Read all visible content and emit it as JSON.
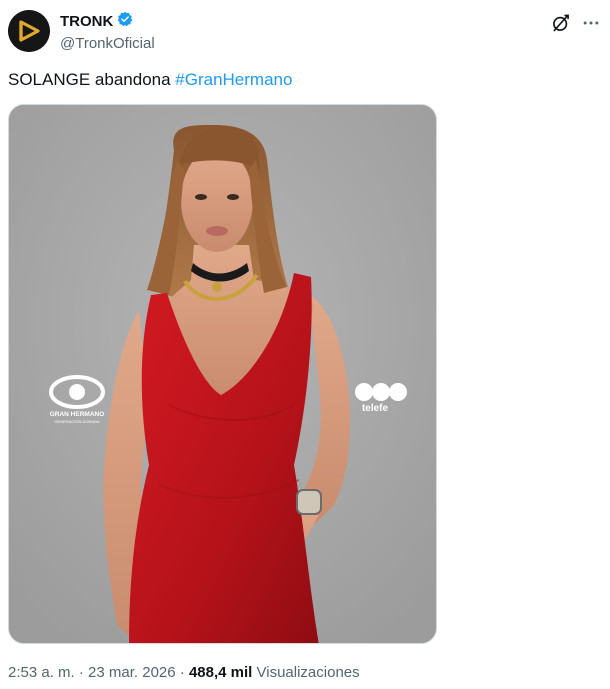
{
  "author": {
    "display_name": "TRONK",
    "handle": "@TronkOficial",
    "verified": true
  },
  "tweet": {
    "text": "SOLANGE abandona ",
    "hashtag": "#GranHermano"
  },
  "media": {
    "logo_left_line1": "GRAN HERMANO",
    "logo_left_line2": "GENERACIÓN DORADA",
    "logo_right": "telefe"
  },
  "meta": {
    "time": "2:53 a. m.",
    "separator": " · ",
    "date": "23 mar. 2026",
    "views_count": "488,4 mil",
    "views_label": "Visualizaciones"
  },
  "colors": {
    "accent": "#1d9bf0",
    "secondary_text": "#536471",
    "dress": "#c4151c",
    "background_photo": "#a8a8a8"
  },
  "icons": {
    "verified": "verified-badge-icon",
    "grok": "grok-icon",
    "more": "more-options-icon"
  }
}
